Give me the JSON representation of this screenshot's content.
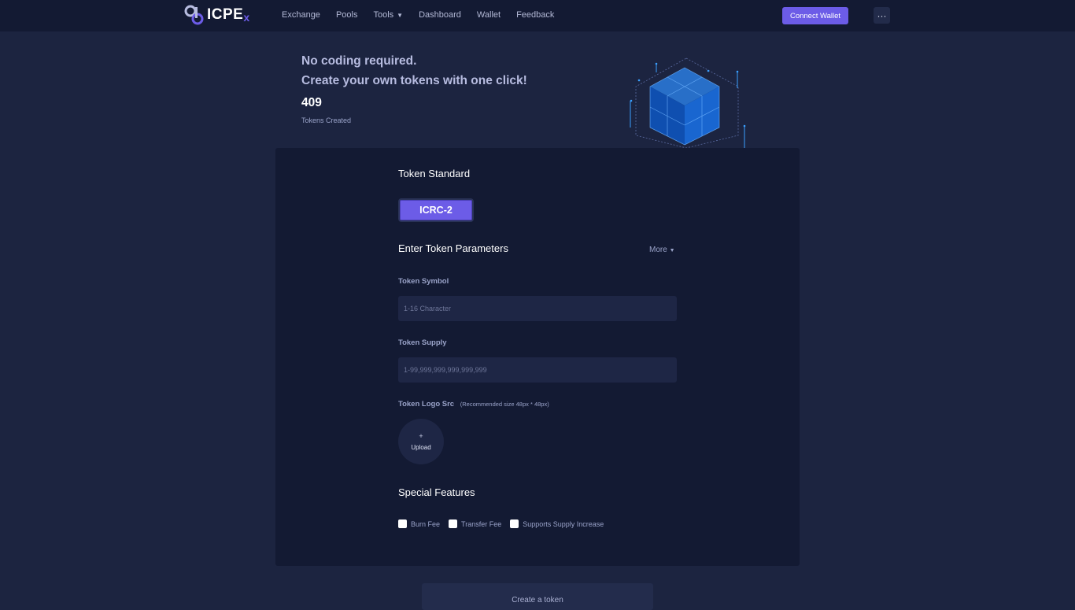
{
  "header": {
    "logo_text": "ICPE",
    "logo_suffix": "x",
    "nav": [
      {
        "label": "Exchange"
      },
      {
        "label": "Pools"
      },
      {
        "label": "Tools"
      },
      {
        "label": "Dashboard"
      },
      {
        "label": "Wallet"
      },
      {
        "label": "Feedback"
      }
    ],
    "connect_label": "Connect Wallet",
    "more_label": "···"
  },
  "hero": {
    "line1": "No coding required.",
    "line2": "Create your own tokens with one click!",
    "count": "409",
    "count_label": "Tokens Created"
  },
  "form": {
    "standard_title": "Token Standard",
    "standard_button": "ICRC-2",
    "params_title": "Enter Token Parameters",
    "more_label": "More",
    "symbol_label": "Token Symbol",
    "symbol_placeholder": "1-16 Character",
    "supply_label": "Token Supply",
    "supply_placeholder": "1-99,999,999,999,999,999",
    "logo_label": "Token Logo Src",
    "logo_hint": "(Recommended size 48px * 48px)",
    "upload_plus": "+",
    "upload_label": "Upload",
    "features_title": "Special Features",
    "features": [
      {
        "label": "Burn Fee"
      },
      {
        "label": "Transfer Fee"
      },
      {
        "label": "Supports Supply Increase"
      }
    ],
    "create_label": "Create a token"
  },
  "colors": {
    "background": "#1c2440",
    "panel": "#131a33",
    "accent": "#6c5ce7"
  }
}
